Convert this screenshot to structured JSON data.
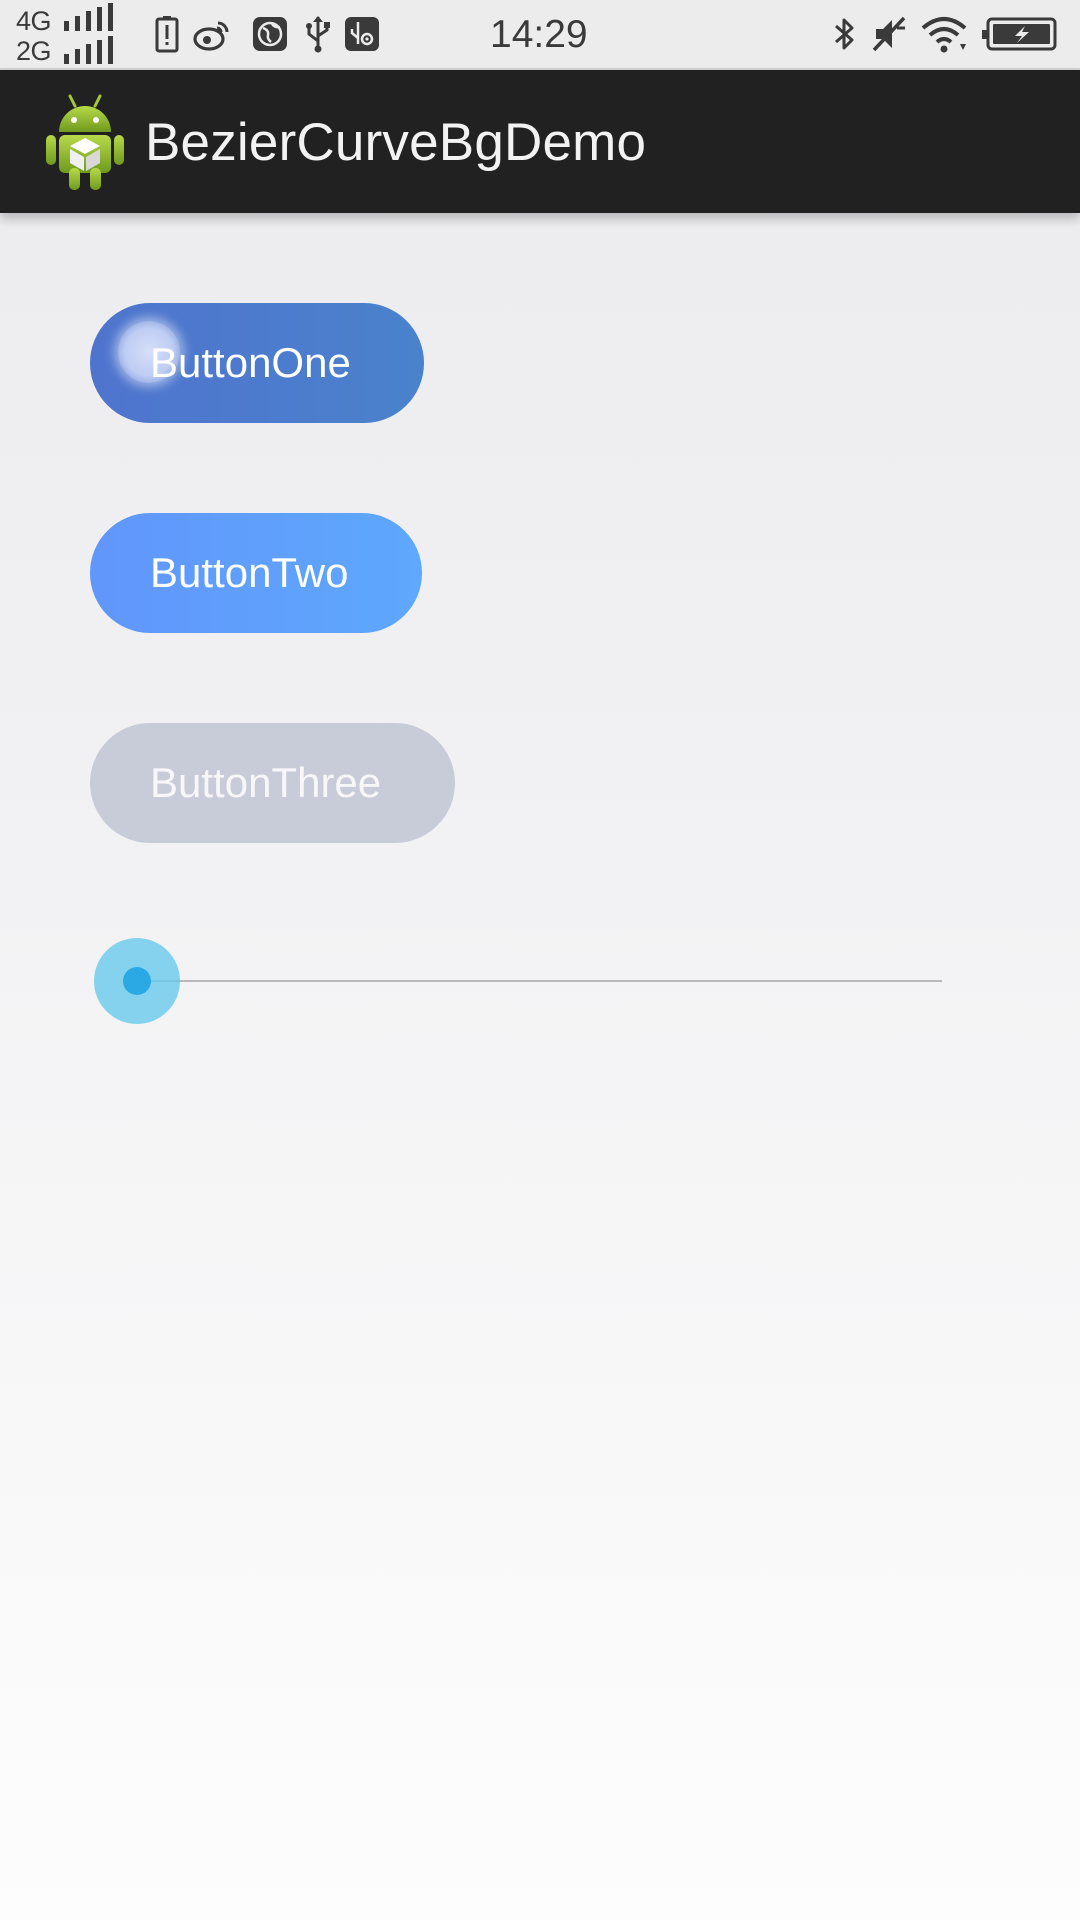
{
  "status_bar": {
    "network_top": "4G",
    "network_bottom": "2G",
    "time": "14:29",
    "left_icons": [
      "battery-alert-icon",
      "weibo-icon",
      "browser-icon",
      "usb-icon",
      "usb-debug-icon"
    ],
    "right_icons": [
      "bluetooth-icon",
      "silent-icon",
      "wifi-icon",
      "battery-charging-icon"
    ]
  },
  "app_bar": {
    "title": "BezierCurveBgDemo",
    "logo": "android-logo-icon"
  },
  "buttons": {
    "one": {
      "label": "ButtonOne",
      "color": "#4f7acd",
      "state": "pressed"
    },
    "two": {
      "label": "ButtonTwo",
      "color": "#5f9efc"
    },
    "three": {
      "label": "ButtonThree",
      "color": "#c8ccd9"
    }
  },
  "seek_bar": {
    "progress": 0,
    "thumb_color": "#2aa9e5"
  }
}
